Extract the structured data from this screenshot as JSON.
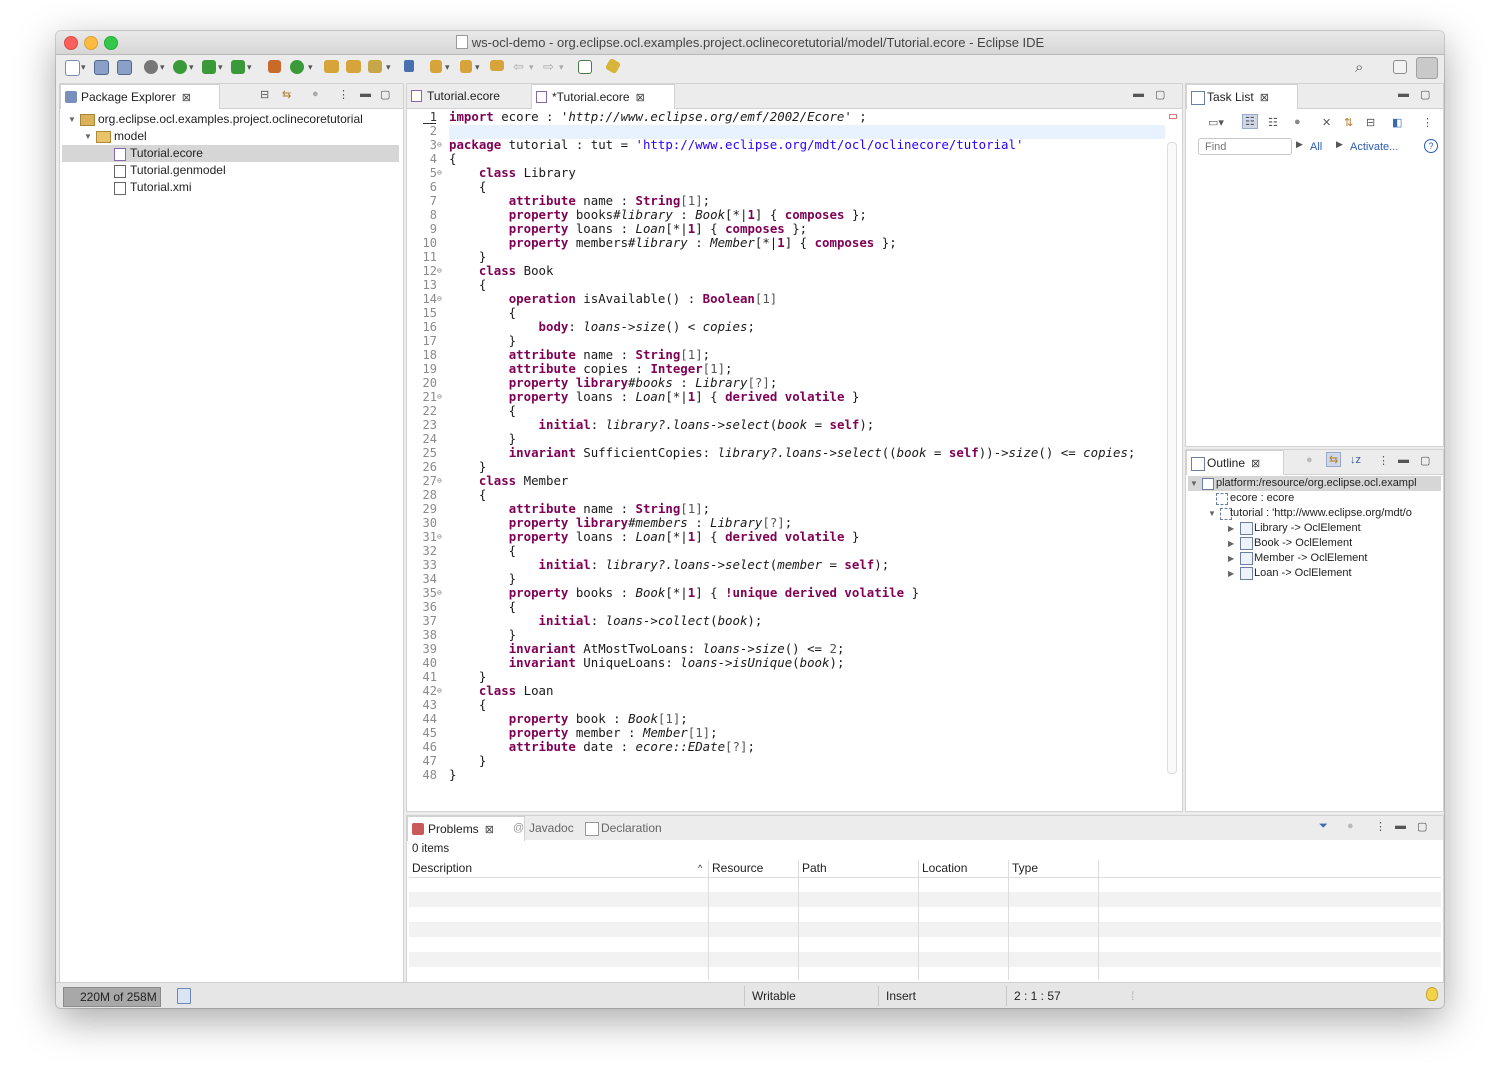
{
  "window": {
    "title": "ws-ocl-demo - org.eclipse.ocl.examples.project.oclinecoretutorial/model/Tutorial.ecore - Eclipse IDE"
  },
  "package_explorer": {
    "tab_label": "Package Explorer",
    "items": [
      {
        "label": "org.eclipse.ocl.examples.project.oclinecoretutorial"
      },
      {
        "label": "model"
      },
      {
        "label": "Tutorial.ecore"
      },
      {
        "label": "Tutorial.genmodel"
      },
      {
        "label": "Tutorial.xmi"
      }
    ]
  },
  "editor": {
    "tabs": [
      {
        "label": "Tutorial.ecore"
      },
      {
        "label": "*Tutorial.ecore"
      }
    ],
    "line_numbers": [
      "1",
      "2",
      "3",
      "4",
      "5",
      "6",
      "7",
      "8",
      "9",
      "10",
      "11",
      "12",
      "13",
      "14",
      "15",
      "16",
      "17",
      "18",
      "19",
      "20",
      "21",
      "22",
      "23",
      "24",
      "25",
      "26",
      "27",
      "28",
      "29",
      "30",
      "31",
      "32",
      "33",
      "34",
      "35",
      "36",
      "37",
      "38",
      "39",
      "40",
      "41",
      "42",
      "43",
      "44",
      "45",
      "46",
      "47",
      "48"
    ],
    "folds": {
      "3": "⊖",
      "5": "⊖",
      "12": "⊖",
      "14": "⊖",
      "21": "⊖",
      "27": "⊖",
      "31": "⊖",
      "35": "⊖",
      "42": "⊖"
    },
    "lines": [
      [
        [
          "kw",
          "import"
        ],
        [
          "n",
          " ecore : "
        ],
        [
          "si",
          "'http://www.eclipse.org/emf/2002/Ecore'"
        ],
        [
          "n",
          " ;"
        ]
      ],
      [],
      [
        [
          "kw",
          "package"
        ],
        [
          "n",
          " tutorial : tut = "
        ],
        [
          "str",
          "'http://www.eclipse.org/mdt/ocl/oclinecore/tutorial'"
        ]
      ],
      [
        [
          "n",
          "{"
        ]
      ],
      [
        [
          "n",
          "    "
        ],
        [
          "kw",
          "class"
        ],
        [
          "n",
          " Library"
        ]
      ],
      [
        [
          "n",
          "    {"
        ]
      ],
      [
        [
          "n",
          "        "
        ],
        [
          "kw",
          "attribute"
        ],
        [
          "n",
          " name : "
        ],
        [
          "kw",
          "String"
        ],
        [
          "num",
          "[1]"
        ],
        [
          "n",
          ";"
        ]
      ],
      [
        [
          "n",
          "        "
        ],
        [
          "kw",
          "property"
        ],
        [
          "n",
          " books#"
        ],
        [
          "it",
          "library"
        ],
        [
          "n",
          " : "
        ],
        [
          "it",
          "Book"
        ],
        [
          "n",
          "[*|"
        ],
        [
          "kw",
          "1"
        ],
        [
          "n",
          "] { "
        ],
        [
          "kw",
          "composes"
        ],
        [
          "n",
          " };"
        ]
      ],
      [
        [
          "n",
          "        "
        ],
        [
          "kw",
          "property"
        ],
        [
          "n",
          " loans : "
        ],
        [
          "it",
          "Loan"
        ],
        [
          "n",
          "[*|"
        ],
        [
          "kw",
          "1"
        ],
        [
          "n",
          "] { "
        ],
        [
          "kw",
          "composes"
        ],
        [
          "n",
          " };"
        ]
      ],
      [
        [
          "n",
          "        "
        ],
        [
          "kw",
          "property"
        ],
        [
          "n",
          " members#"
        ],
        [
          "it",
          "library"
        ],
        [
          "n",
          " : "
        ],
        [
          "it",
          "Member"
        ],
        [
          "n",
          "[*|"
        ],
        [
          "kw",
          "1"
        ],
        [
          "n",
          "] { "
        ],
        [
          "kw",
          "composes"
        ],
        [
          "n",
          " };"
        ]
      ],
      [
        [
          "n",
          "    }"
        ]
      ],
      [
        [
          "n",
          "    "
        ],
        [
          "kw",
          "class"
        ],
        [
          "n",
          " Book"
        ]
      ],
      [
        [
          "n",
          "    {"
        ]
      ],
      [
        [
          "n",
          "        "
        ],
        [
          "kw",
          "operation"
        ],
        [
          "n",
          " isAvailable() : "
        ],
        [
          "kw",
          "Boolean"
        ],
        [
          "num",
          "[1]"
        ]
      ],
      [
        [
          "n",
          "        {"
        ]
      ],
      [
        [
          "n",
          "            "
        ],
        [
          "kw",
          "body"
        ],
        [
          "n",
          ": "
        ],
        [
          "it",
          "loans->size"
        ],
        [
          "n",
          "() < "
        ],
        [
          "it",
          "copies"
        ],
        [
          "n",
          ";"
        ]
      ],
      [
        [
          "n",
          "        }"
        ]
      ],
      [
        [
          "n",
          "        "
        ],
        [
          "kw",
          "attribute"
        ],
        [
          "n",
          " name : "
        ],
        [
          "kw",
          "String"
        ],
        [
          "num",
          "[1]"
        ],
        [
          "n",
          ";"
        ]
      ],
      [
        [
          "n",
          "        "
        ],
        [
          "kw",
          "attribute"
        ],
        [
          "n",
          " copies : "
        ],
        [
          "kw",
          "Integer"
        ],
        [
          "num",
          "[1]"
        ],
        [
          "n",
          ";"
        ]
      ],
      [
        [
          "n",
          "        "
        ],
        [
          "kw",
          "property"
        ],
        [
          "n",
          " "
        ],
        [
          "kw",
          "library"
        ],
        [
          "n",
          "#"
        ],
        [
          "it",
          "books"
        ],
        [
          "n",
          " : "
        ],
        [
          "it",
          "Library"
        ],
        [
          "num",
          "[?]"
        ],
        [
          "n",
          ";"
        ]
      ],
      [
        [
          "n",
          "        "
        ],
        [
          "kw",
          "property"
        ],
        [
          "n",
          " loans : "
        ],
        [
          "it",
          "Loan"
        ],
        [
          "n",
          "[*|"
        ],
        [
          "kw",
          "1"
        ],
        [
          "n",
          "] { "
        ],
        [
          "kw",
          "derived volatile"
        ],
        [
          "n",
          " }"
        ]
      ],
      [
        [
          "n",
          "        {"
        ]
      ],
      [
        [
          "n",
          "            "
        ],
        [
          "kw",
          "initial"
        ],
        [
          "n",
          ": "
        ],
        [
          "it",
          "library?.loans->select"
        ],
        [
          "n",
          "("
        ],
        [
          "it",
          "book"
        ],
        [
          "n",
          " = "
        ],
        [
          "kw",
          "self"
        ],
        [
          "n",
          ");"
        ]
      ],
      [
        [
          "n",
          "        }"
        ]
      ],
      [
        [
          "n",
          "        "
        ],
        [
          "kw",
          "invariant"
        ],
        [
          "n",
          " SufficientCopies: "
        ],
        [
          "it",
          "library?.loans->select"
        ],
        [
          "n",
          "(("
        ],
        [
          "it",
          "book"
        ],
        [
          "n",
          " = "
        ],
        [
          "kw",
          "self"
        ],
        [
          "n",
          "))->"
        ],
        [
          "it",
          "size"
        ],
        [
          "n",
          "() <= "
        ],
        [
          "it",
          "copies"
        ],
        [
          "n",
          ";"
        ]
      ],
      [
        [
          "n",
          "    }"
        ]
      ],
      [
        [
          "n",
          "    "
        ],
        [
          "kw",
          "class"
        ],
        [
          "n",
          " Member"
        ]
      ],
      [
        [
          "n",
          "    {"
        ]
      ],
      [
        [
          "n",
          "        "
        ],
        [
          "kw",
          "attribute"
        ],
        [
          "n",
          " name : "
        ],
        [
          "kw",
          "String"
        ],
        [
          "num",
          "[1]"
        ],
        [
          "n",
          ";"
        ]
      ],
      [
        [
          "n",
          "        "
        ],
        [
          "kw",
          "property"
        ],
        [
          "n",
          " "
        ],
        [
          "kw",
          "library"
        ],
        [
          "n",
          "#"
        ],
        [
          "it",
          "members"
        ],
        [
          "n",
          " : "
        ],
        [
          "it",
          "Library"
        ],
        [
          "num",
          "[?]"
        ],
        [
          "n",
          ";"
        ]
      ],
      [
        [
          "n",
          "        "
        ],
        [
          "kw",
          "property"
        ],
        [
          "n",
          " loans : "
        ],
        [
          "it",
          "Loan"
        ],
        [
          "n",
          "[*|"
        ],
        [
          "kw",
          "1"
        ],
        [
          "n",
          "] { "
        ],
        [
          "kw",
          "derived volatile"
        ],
        [
          "n",
          " }"
        ]
      ],
      [
        [
          "n",
          "        {"
        ]
      ],
      [
        [
          "n",
          "            "
        ],
        [
          "kw",
          "initial"
        ],
        [
          "n",
          ": "
        ],
        [
          "it",
          "library?.loans->select"
        ],
        [
          "n",
          "("
        ],
        [
          "it",
          "member"
        ],
        [
          "n",
          " = "
        ],
        [
          "kw",
          "self"
        ],
        [
          "n",
          ");"
        ]
      ],
      [
        [
          "n",
          "        }"
        ]
      ],
      [
        [
          "n",
          "        "
        ],
        [
          "kw",
          "property"
        ],
        [
          "n",
          " books : "
        ],
        [
          "it",
          "Book"
        ],
        [
          "n",
          "[*|"
        ],
        [
          "kw",
          "1"
        ],
        [
          "n",
          "] { "
        ],
        [
          "kw",
          "!unique derived volatile"
        ],
        [
          "n",
          " }"
        ]
      ],
      [
        [
          "n",
          "        {"
        ]
      ],
      [
        [
          "n",
          "            "
        ],
        [
          "kw",
          "initial"
        ],
        [
          "n",
          ": "
        ],
        [
          "it",
          "loans->collect"
        ],
        [
          "n",
          "("
        ],
        [
          "it",
          "book"
        ],
        [
          "n",
          ");"
        ]
      ],
      [
        [
          "n",
          "        }"
        ]
      ],
      [
        [
          "n",
          "        "
        ],
        [
          "kw",
          "invariant"
        ],
        [
          "n",
          " AtMostTwoLoans: "
        ],
        [
          "it",
          "loans->size"
        ],
        [
          "n",
          "() <= "
        ],
        [
          "num",
          "2"
        ],
        [
          "n",
          ";"
        ]
      ],
      [
        [
          "n",
          "        "
        ],
        [
          "kw",
          "invariant"
        ],
        [
          "n",
          " UniqueLoans: "
        ],
        [
          "it",
          "loans->isUnique"
        ],
        [
          "n",
          "("
        ],
        [
          "it",
          "book"
        ],
        [
          "n",
          ");"
        ]
      ],
      [
        [
          "n",
          "    }"
        ]
      ],
      [
        [
          "n",
          "    "
        ],
        [
          "kw",
          "class"
        ],
        [
          "n",
          " Loan"
        ]
      ],
      [
        [
          "n",
          "    {"
        ]
      ],
      [
        [
          "n",
          "        "
        ],
        [
          "kw",
          "property"
        ],
        [
          "n",
          " book : "
        ],
        [
          "it",
          "Book"
        ],
        [
          "num",
          "[1]"
        ],
        [
          "n",
          ";"
        ]
      ],
      [
        [
          "n",
          "        "
        ],
        [
          "kw",
          "property"
        ],
        [
          "n",
          " member : "
        ],
        [
          "it",
          "Member"
        ],
        [
          "num",
          "[1]"
        ],
        [
          "n",
          ";"
        ]
      ],
      [
        [
          "n",
          "        "
        ],
        [
          "kw",
          "attribute"
        ],
        [
          "n",
          " date : "
        ],
        [
          "it",
          "ecore::EDate"
        ],
        [
          "num",
          "[?]"
        ],
        [
          "n",
          ";"
        ]
      ],
      [
        [
          "n",
          "    }"
        ]
      ],
      [
        [
          "n",
          "}"
        ]
      ]
    ]
  },
  "task_list": {
    "tab_label": "Task List",
    "find_placeholder": "Find",
    "all_label": "All",
    "activate_label": "Activate..."
  },
  "outline": {
    "tab_label": "Outline",
    "items": [
      {
        "label": "platform:/resource/org.eclipse.ocl.exampl"
      },
      {
        "label": "ecore : ecore"
      },
      {
        "label": "tutorial : 'http://www.eclipse.org/mdt/o"
      },
      {
        "label": "Library -> OclElement"
      },
      {
        "label": "Book -> OclElement"
      },
      {
        "label": "Member -> OclElement"
      },
      {
        "label": "Loan -> OclElement"
      }
    ]
  },
  "problems": {
    "tabs": [
      {
        "label": "Problems"
      },
      {
        "label": "Javadoc"
      },
      {
        "label": "Declaration"
      }
    ],
    "count": "0 items",
    "columns": [
      "Description",
      "Resource",
      "Path",
      "Location",
      "Type"
    ]
  },
  "status": {
    "heap": "220M of 258M",
    "writable": "Writable",
    "insert": "Insert",
    "position": "2 : 1 : 57"
  },
  "colors": {
    "keyword": "#7f0055",
    "string": "#2a00ff",
    "selection": "#d6d6d6"
  }
}
